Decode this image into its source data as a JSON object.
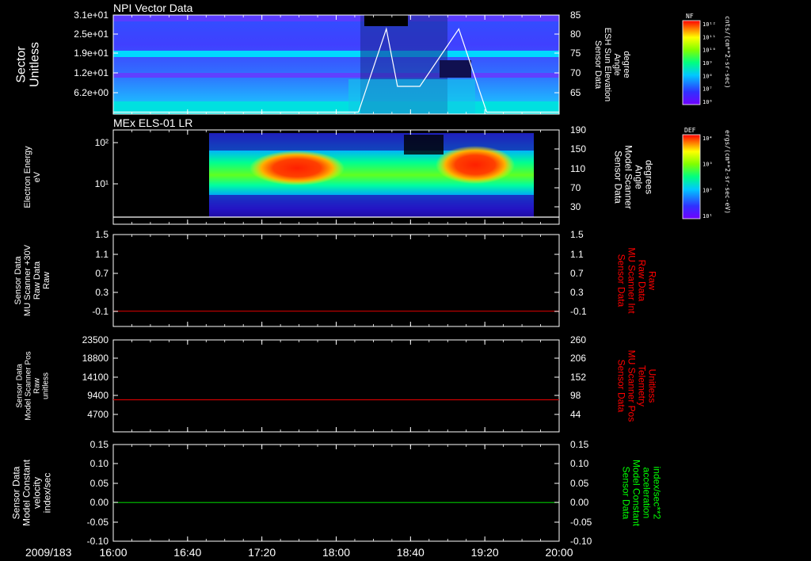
{
  "chart_data": {
    "type": "multi-panel",
    "time_axis": {
      "date_label": "2009/183",
      "ticks": [
        "16:00",
        "16:40",
        "17:20",
        "18:00",
        "18:40",
        "19:20",
        "20:00"
      ],
      "range_hours": [
        16,
        20
      ]
    },
    "panels": [
      {
        "id": "npi",
        "type": "heatmap",
        "title": "NPI Vector Data",
        "left_label": [
          "Sector",
          "Unitless"
        ],
        "left_ticks": [
          "3.1e+01",
          "2.5e+01",
          "1.9e+01",
          "1.2e+01",
          "6.2e+00"
        ],
        "right_label": [
          "Sensor Data",
          "ESH Sun Elevation",
          "Angle",
          "degree"
        ],
        "right_ticks": [
          "85",
          "80",
          "75",
          "70",
          "65"
        ],
        "right_range": [
          60,
          85
        ],
        "overlay_series": {
          "name": "ESH Sun Elevation Angle",
          "color": "#ffffff",
          "x_hours": [
            16.0,
            18.2,
            18.45,
            18.55,
            18.75,
            19.1,
            19.35,
            19.45,
            19.6,
            20.0
          ],
          "y_deg": [
            60.5,
            60.5,
            81.5,
            67,
            67,
            81.5,
            60.5,
            60.5,
            60.5,
            60.5
          ]
        }
      },
      {
        "id": "els",
        "type": "heatmap",
        "title": "MEx ELS-01 LR",
        "left_label": [
          "Electron Energy",
          "eV"
        ],
        "left_ticks": [
          "10²",
          "10¹"
        ],
        "right_label": [
          "Sensor Data",
          "Model Scanner",
          "Angle",
          "degrees"
        ],
        "right_ticks": [
          "190",
          "150",
          "110",
          "70",
          "30"
        ],
        "right_range": [
          10,
          190
        ],
        "overlay_series": {
          "name": "Model Scanner Angle",
          "color": "#ffffff",
          "x_hours": [
            16.0,
            20.0
          ],
          "y_deg": [
            10,
            10
          ]
        }
      },
      {
        "id": "mu_int",
        "type": "line",
        "left_label": [
          "Sensor Data",
          "MU Scanner +30V",
          "Raw Data",
          "Raw"
        ],
        "left_ticks": [
          "1.5",
          "1.1",
          "0.7",
          "0.3",
          "-0.1"
        ],
        "left_range": [
          -0.3,
          1.5
        ],
        "right_label": [
          "Sensor Data",
          "MU Scanner Int",
          "Raw Data",
          "Raw"
        ],
        "right_ticks": [
          "1.5",
          "1.1",
          "0.7",
          "0.3",
          "-0.1"
        ],
        "right_label_color": "#ff0000",
        "series": [
          {
            "color": "#cc0000",
            "x_hours": [
              16.0,
              20.0
            ],
            "y": [
              0.0,
              0.0
            ]
          }
        ]
      },
      {
        "id": "mu_pos",
        "type": "line",
        "left_label": [
          "Sensor Data",
          "Model Scanner Pos",
          "Raw",
          "unitless"
        ],
        "left_ticks": [
          "23500",
          "18800",
          "14100",
          "9400",
          "4700"
        ],
        "left_range": [
          0,
          23500
        ],
        "right_label": [
          "Sensor Data",
          "MU Scanner Pos",
          "Telemetry",
          "Unitless"
        ],
        "right_ticks": [
          "260",
          "206",
          "152",
          "98",
          "44"
        ],
        "right_label_color": "#ff0000",
        "series": [
          {
            "color": "#cc0000",
            "x_hours": [
              16.0,
              20.0
            ],
            "y": [
              8200,
              8200
            ]
          }
        ]
      },
      {
        "id": "model_const",
        "type": "line",
        "left_label": [
          "Sensor Data",
          "Model Constant",
          "velocity",
          "index/sec"
        ],
        "left_ticks": [
          "0.15",
          "0.10",
          "0.05",
          "0.00",
          "-0.05",
          "-0.10"
        ],
        "left_range": [
          -0.1,
          0.15
        ],
        "right_label": [
          "Sensor Data",
          "Model Constant",
          "acceleration",
          "index/sec**2"
        ],
        "right_ticks": [
          "0.15",
          "0.10",
          "0.05",
          "0.00",
          "-0.05",
          "-0.10"
        ],
        "right_label_color": "#00ff00",
        "series": [
          {
            "color": "#00c800",
            "x_hours": [
              16.0,
              20.0
            ],
            "y": [
              0.0,
              0.0
            ]
          }
        ]
      }
    ],
    "colorbars": [
      {
        "id": "nf",
        "title": "NF",
        "unit_label": "cnts/(cm**2-sr-sec)",
        "tick_labels": [
          "10¹²",
          "10¹¹",
          "10¹⁰",
          "10⁹",
          "10⁸",
          "10⁷",
          "10⁶"
        ]
      },
      {
        "id": "def",
        "title": "DEF",
        "unit_label": "ergs/(cm**2-sr-sec-eV)",
        "tick_labels": [
          "10⁴",
          "10³",
          "10²",
          "10¹"
        ]
      }
    ]
  }
}
